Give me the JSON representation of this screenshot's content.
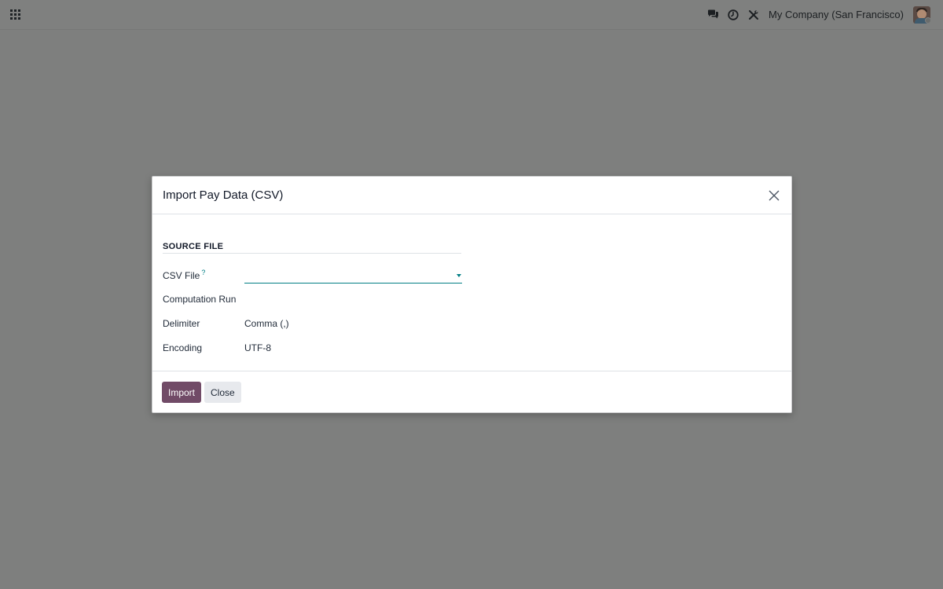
{
  "navbar": {
    "apps_icon": "grid-icon",
    "icons": [
      "chat-icon",
      "clock-icon",
      "tools-icon"
    ],
    "company": "My Company (San Francisco)",
    "avatar": "avatar"
  },
  "dialog": {
    "title": "Import Pay Data (CSV)",
    "section_title": "SOURCE FILE",
    "fields": {
      "csv_file_label": "CSV File",
      "csv_file_help": "?",
      "csv_file_value": "",
      "computation_run_label": "Computation Run",
      "delimiter_label": "Delimiter",
      "delimiter_value": "Comma (,)",
      "encoding_label": "Encoding",
      "encoding_value": "UTF-8"
    },
    "buttons": {
      "import": "Import",
      "close": "Close"
    }
  },
  "colors": {
    "primary": "#714b67",
    "accent": "#017e84",
    "backdrop": "#7e7f7e"
  }
}
